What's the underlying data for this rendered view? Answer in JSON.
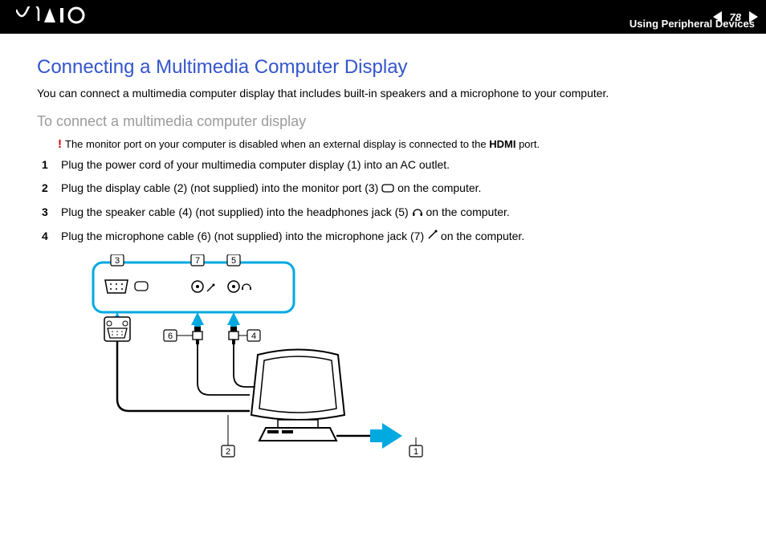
{
  "header": {
    "logo_text": "VAIO",
    "page_number": "78",
    "section": "Using Peripheral Devices"
  },
  "page": {
    "title": "Connecting a Multimedia Computer Display",
    "intro": "You can connect a multimedia computer display that includes built-in speakers and a microphone to your computer.",
    "subtitle": "To connect a multimedia computer display",
    "warning_prefix": "The monitor port on your computer is disabled when an external display is connected to the ",
    "warning_bold": "HDMI",
    "warning_suffix": " port.",
    "steps": [
      {
        "n": "1",
        "text": "Plug the power cord of your multimedia computer display (1) into an AC outlet."
      },
      {
        "n": "2",
        "pre": "Plug the display cable (2) (not supplied) into the monitor port (3) ",
        "icon": "monitor-port",
        "post": " on the computer."
      },
      {
        "n": "3",
        "pre": "Plug the speaker cable (4) (not supplied) into the headphones jack (5) ",
        "icon": "headphones",
        "post": " on the computer."
      },
      {
        "n": "4",
        "pre": "Plug the microphone cable (6) (not supplied) into the microphone jack (7) ",
        "icon": "microphone",
        "post": " on the computer."
      }
    ],
    "diagram_callouts": [
      "1",
      "2",
      "3",
      "4",
      "5",
      "6",
      "7"
    ]
  }
}
